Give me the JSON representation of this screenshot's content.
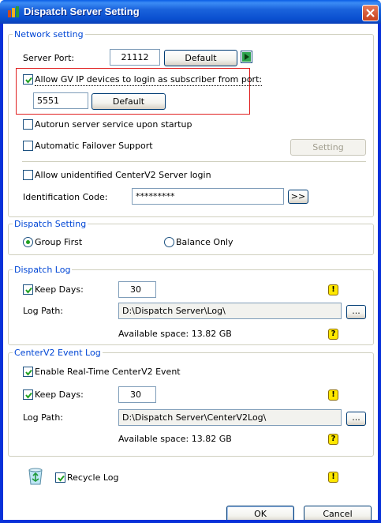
{
  "window": {
    "title": "Dispatch Server Setting"
  },
  "network": {
    "title": "Network setting",
    "server_port_label": "Server Port:",
    "server_port_value": "21112",
    "default_label": "Default",
    "allow_gv_label": "Allow GV IP devices to login as subscriber from port:",
    "allow_gv_checked": true,
    "gv_port_value": "5551",
    "gv_default_label": "Default",
    "autorun_label": "Autorun server service upon startup",
    "autorun_checked": false,
    "failover_label": "Automatic Failover Support",
    "failover_checked": false,
    "setting_label": "Setting",
    "allow_unidentified_label": "Allow unidentified CenterV2 Server login",
    "allow_unidentified_checked": false,
    "identification_label": "Identification Code:",
    "identification_value": "*********",
    "more_label": ">>"
  },
  "dispatch_setting": {
    "title": "Dispatch Setting",
    "group_first_label": "Group First",
    "group_first_selected": true,
    "balance_only_label": "Balance Only",
    "balance_only_selected": false
  },
  "dispatch_log": {
    "title": "Dispatch Log",
    "keep_days_label": "Keep Days:",
    "keep_days_checked": true,
    "keep_days_value": "30",
    "log_path_label": "Log Path:",
    "log_path_value": "D:\\Dispatch Server\\Log\\",
    "browse_label": "...",
    "available_space": "Available space: 13.82 GB"
  },
  "centerv2_log": {
    "title": "CenterV2 Event Log",
    "enable_realtime_label": "Enable Real-Time CenterV2 Event",
    "enable_realtime_checked": true,
    "keep_days_label": "Keep Days:",
    "keep_days_checked": true,
    "keep_days_value": "30",
    "log_path_label": "Log Path:",
    "log_path_value": "D:\\Dispatch Server\\CenterV2Log\\",
    "browse_label": "...",
    "available_space": "Available space: 13.82 GB"
  },
  "recycle": {
    "label": "Recycle Log",
    "checked": true
  },
  "footer": {
    "ok_label": "OK",
    "cancel_label": "Cancel"
  },
  "icons": {
    "warning_glyph": "!",
    "help_glyph": "?"
  },
  "colors": {
    "title_bar": "#0a4fd0",
    "group_title": "#0046d5",
    "highlight_border": "#e02020",
    "warning_fill": "#ffe800"
  }
}
